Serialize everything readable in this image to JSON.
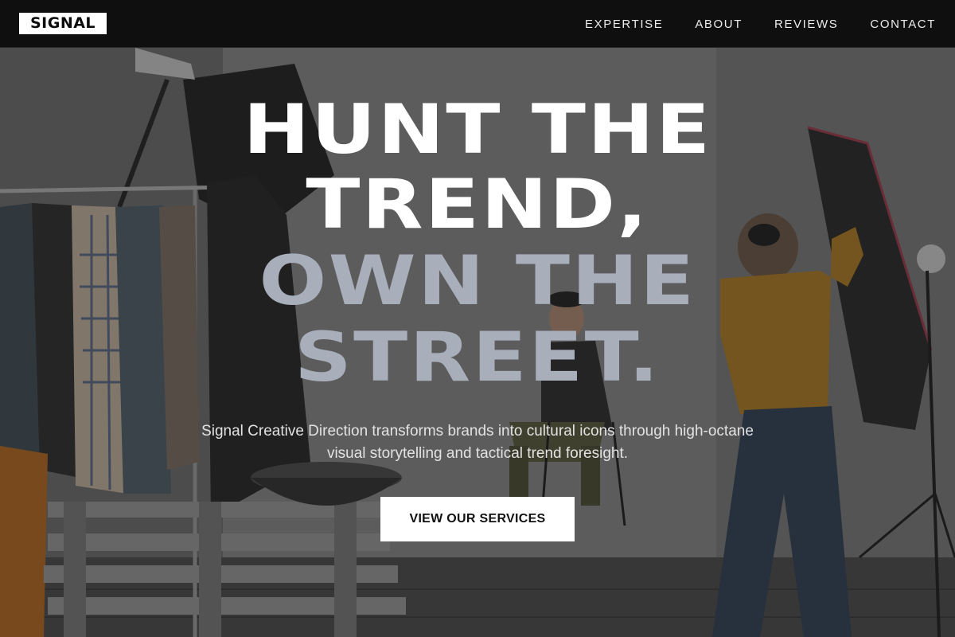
{
  "brand": {
    "logo_text": "SIGNAL"
  },
  "nav": {
    "items": [
      {
        "label": "EXPERTISE"
      },
      {
        "label": "ABOUT"
      },
      {
        "label": "REVIEWS"
      },
      {
        "label": "CONTACT"
      }
    ]
  },
  "hero": {
    "headline_lines": [
      "HUNT THE",
      "TREND,",
      "OWN THE",
      "STREET."
    ],
    "subtext": "Signal Creative Direction transforms brands into cultural icons through high-octane visual storytelling and tactical trend foresight.",
    "cta_label": "VIEW OUR SERVICES"
  },
  "colors": {
    "navbar_bg": "#0f0f0f",
    "headline_primary": "#ffffff",
    "headline_secondary": "#a9aebb",
    "cta_bg": "#ffffff",
    "cta_text": "#111111"
  }
}
